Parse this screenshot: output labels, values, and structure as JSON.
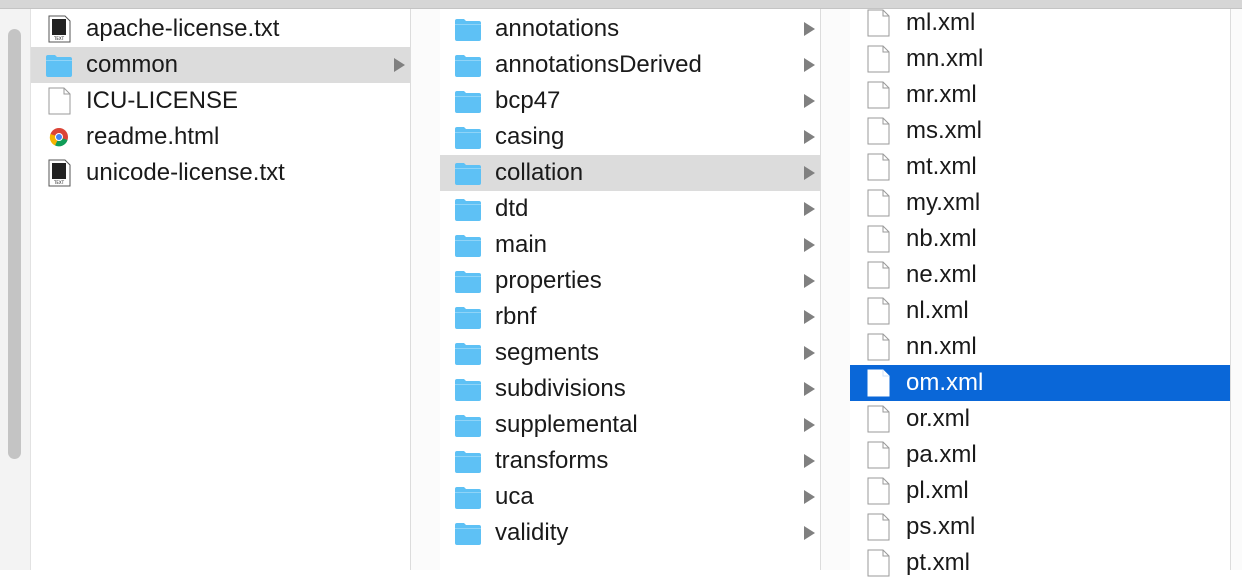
{
  "column1": {
    "items": [
      {
        "label": "apache-license.txt",
        "icon": "text-file-icon"
      },
      {
        "label": "common",
        "icon": "folder-icon",
        "selected": true,
        "has_children": true
      },
      {
        "label": "ICU-LICENSE",
        "icon": "document-icon"
      },
      {
        "label": "readme.html",
        "icon": "chrome-html-icon"
      },
      {
        "label": "unicode-license.txt",
        "icon": "text-file-icon"
      }
    ]
  },
  "column2": {
    "items": [
      {
        "label": "annotations"
      },
      {
        "label": "annotationsDerived"
      },
      {
        "label": "bcp47"
      },
      {
        "label": "casing"
      },
      {
        "label": "collation",
        "selected": true
      },
      {
        "label": "dtd"
      },
      {
        "label": "main"
      },
      {
        "label": "properties"
      },
      {
        "label": "rbnf"
      },
      {
        "label": "segments"
      },
      {
        "label": "subdivisions"
      },
      {
        "label": "supplemental"
      },
      {
        "label": "transforms"
      },
      {
        "label": "uca"
      },
      {
        "label": "validity"
      }
    ]
  },
  "column3": {
    "items": [
      {
        "label": "ml.xml"
      },
      {
        "label": "mn.xml"
      },
      {
        "label": "mr.xml"
      },
      {
        "label": "ms.xml"
      },
      {
        "label": "mt.xml"
      },
      {
        "label": "my.xml"
      },
      {
        "label": "nb.xml"
      },
      {
        "label": "ne.xml"
      },
      {
        "label": "nl.xml"
      },
      {
        "label": "nn.xml"
      },
      {
        "label": "om.xml",
        "selected": true
      },
      {
        "label": "or.xml"
      },
      {
        "label": "pa.xml"
      },
      {
        "label": "pl.xml"
      },
      {
        "label": "ps.xml"
      },
      {
        "label": "pt.xml"
      }
    ]
  },
  "colors": {
    "folder_blue": "#5ec1f5",
    "selection_gray": "#dcdcdc",
    "selection_blue": "#0a67d8"
  }
}
